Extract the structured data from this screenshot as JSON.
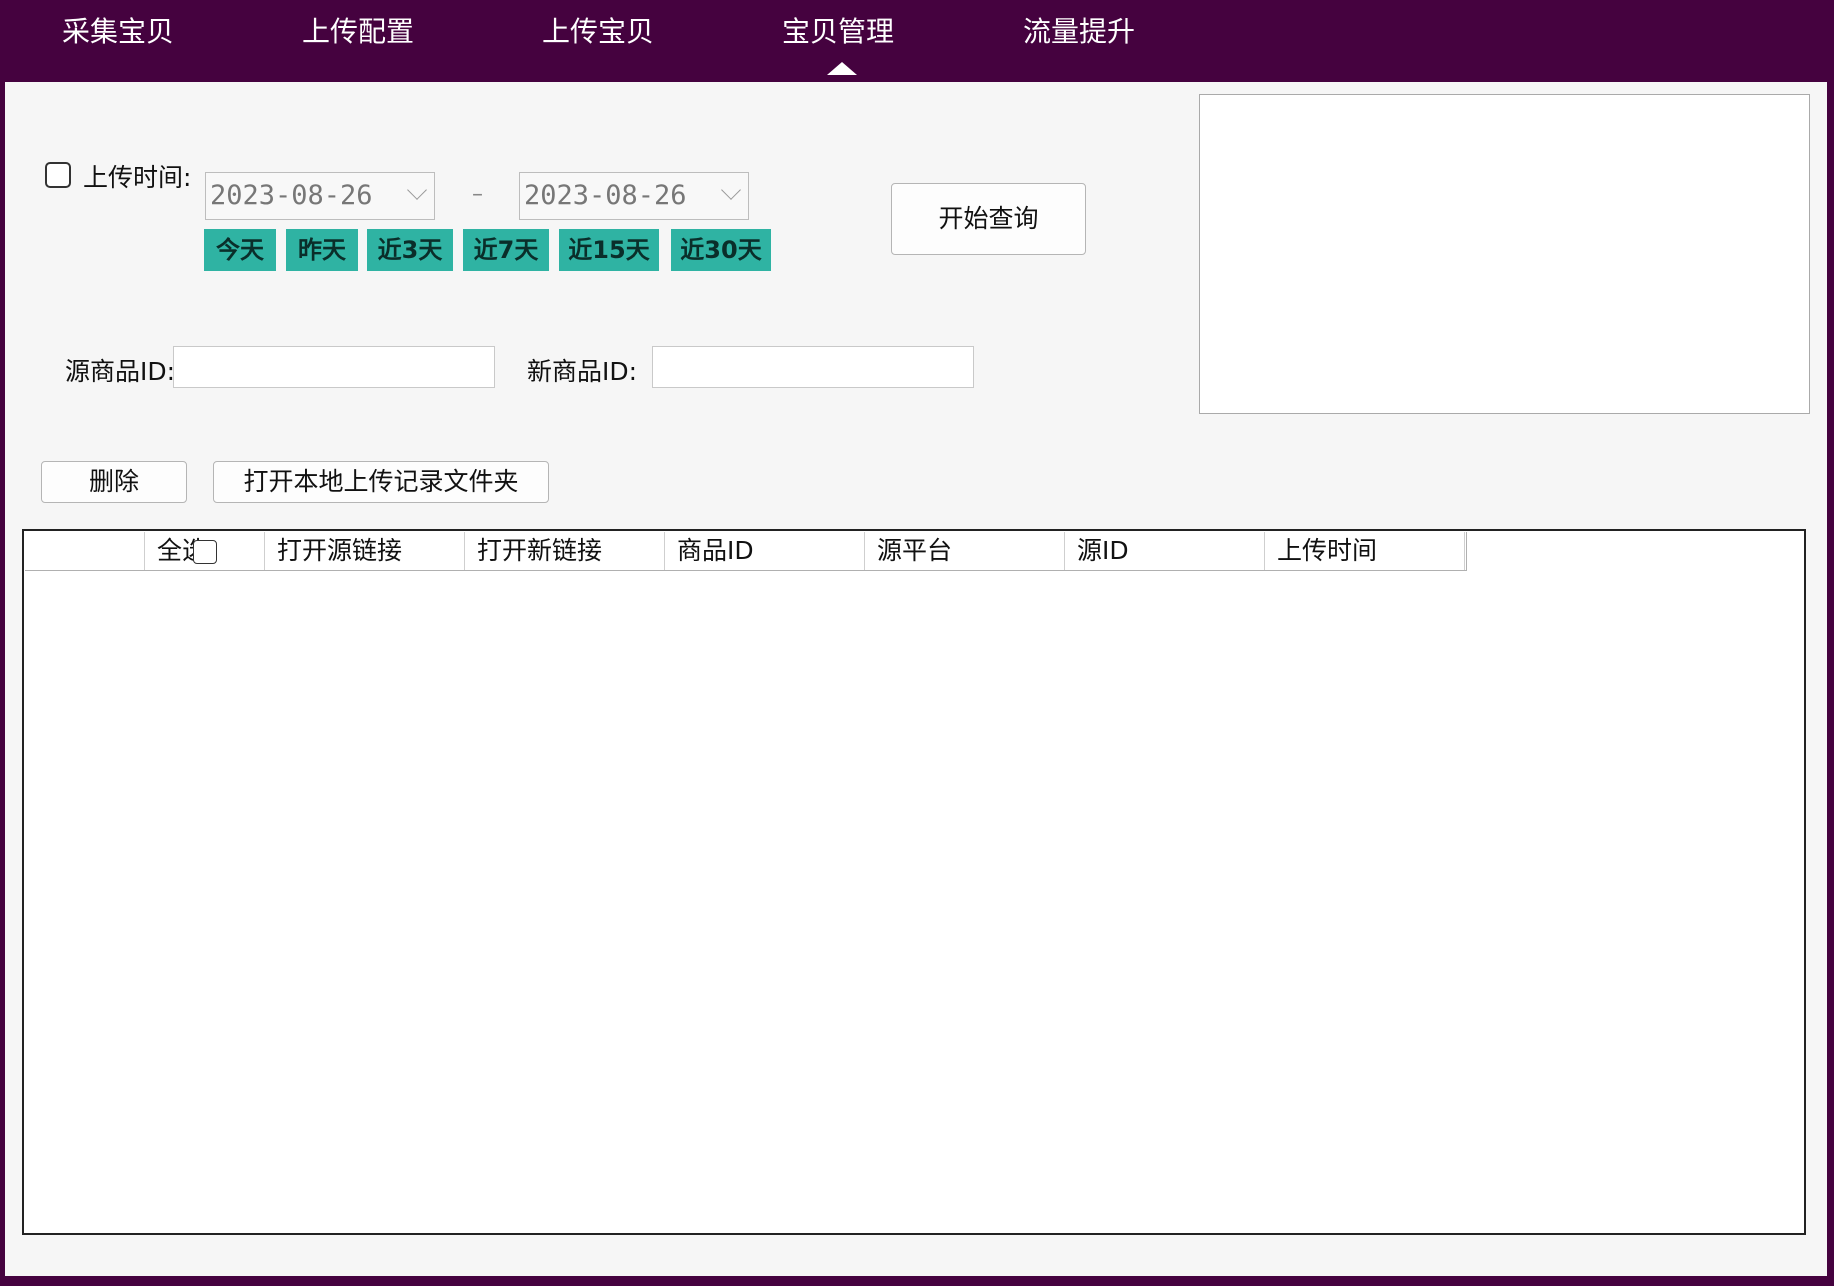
{
  "nav": {
    "items": [
      {
        "label": "采集宝贝"
      },
      {
        "label": "上传配置"
      },
      {
        "label": "上传宝贝"
      },
      {
        "label": "宝贝管理",
        "active": true
      },
      {
        "label": "流量提升"
      }
    ]
  },
  "filters": {
    "upload_time_label": "上传时间:",
    "upload_time_checked": false,
    "start_date": "2023-08-26",
    "separator": "–",
    "end_date": "2023-08-26",
    "quick_ranges": [
      "今天",
      "昨天",
      "近3天",
      "近7天",
      "近15天",
      "近30天"
    ],
    "query_button": "开始查询",
    "source_id_label": "源商品ID:",
    "source_id_value": "",
    "new_id_label": "新商品ID:",
    "new_id_value": ""
  },
  "actions": {
    "delete_button": "删除",
    "open_folder_button": "打开本地上传记录文件夹"
  },
  "table": {
    "columns": [
      "",
      "全选",
      "打开源链接",
      "打开新链接",
      "商品ID",
      "源平台",
      "源ID",
      "上传时间"
    ],
    "select_all_checked": false,
    "rows": []
  },
  "colors": {
    "frame": "#45023f",
    "quick_button": "#2fb3a3",
    "panel": "#f6f6f6"
  }
}
